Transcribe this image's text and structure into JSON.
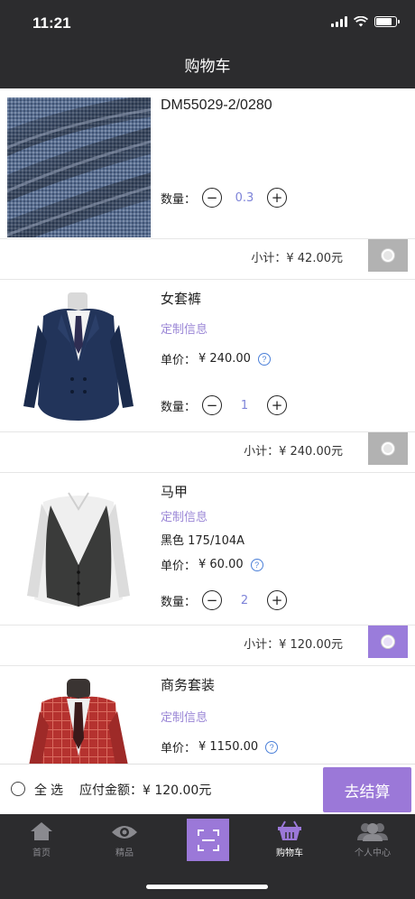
{
  "status": {
    "time": "11:21"
  },
  "nav": {
    "title": "购物车"
  },
  "labels": {
    "quantity": "数量：",
    "unit_price": "单价：",
    "custom_info": "定制信息",
    "subtotal_prefix": "小计："
  },
  "items": [
    {
      "name": "DM55029-2/0280",
      "quantity": "0.3",
      "subtotal": "¥ 42.00元",
      "selected": false
    },
    {
      "name": "女套裤",
      "price": "¥ 240.00",
      "quantity": "1",
      "subtotal": "¥ 240.00元",
      "selected": false
    },
    {
      "name": "马甲",
      "spec": "黑色 175/104A",
      "price": "¥ 60.00",
      "quantity": "2",
      "subtotal": "¥ 120.00元",
      "selected": true
    },
    {
      "name": "商务套装",
      "price": "¥ 1150.00"
    }
  ],
  "footer": {
    "select_all": "全选",
    "total_label": "应付金额：",
    "total_value": "¥ 120.00元",
    "checkout": "去结算"
  },
  "tabs": [
    {
      "label": "首页",
      "icon": "home-icon"
    },
    {
      "label": "精品",
      "icon": "eye-icon"
    },
    {
      "label": "",
      "icon": "scan-icon"
    },
    {
      "label": "购物车",
      "icon": "basket-icon",
      "active": true
    },
    {
      "label": "个人中心",
      "icon": "users-icon"
    }
  ],
  "colors": {
    "accent": "#9b78d8",
    "dark_bar": "#2c2c2e",
    "custom_info": "#9a86d6",
    "quantity_value": "#7d83d8",
    "unselected_box": "#b2b2b2"
  }
}
